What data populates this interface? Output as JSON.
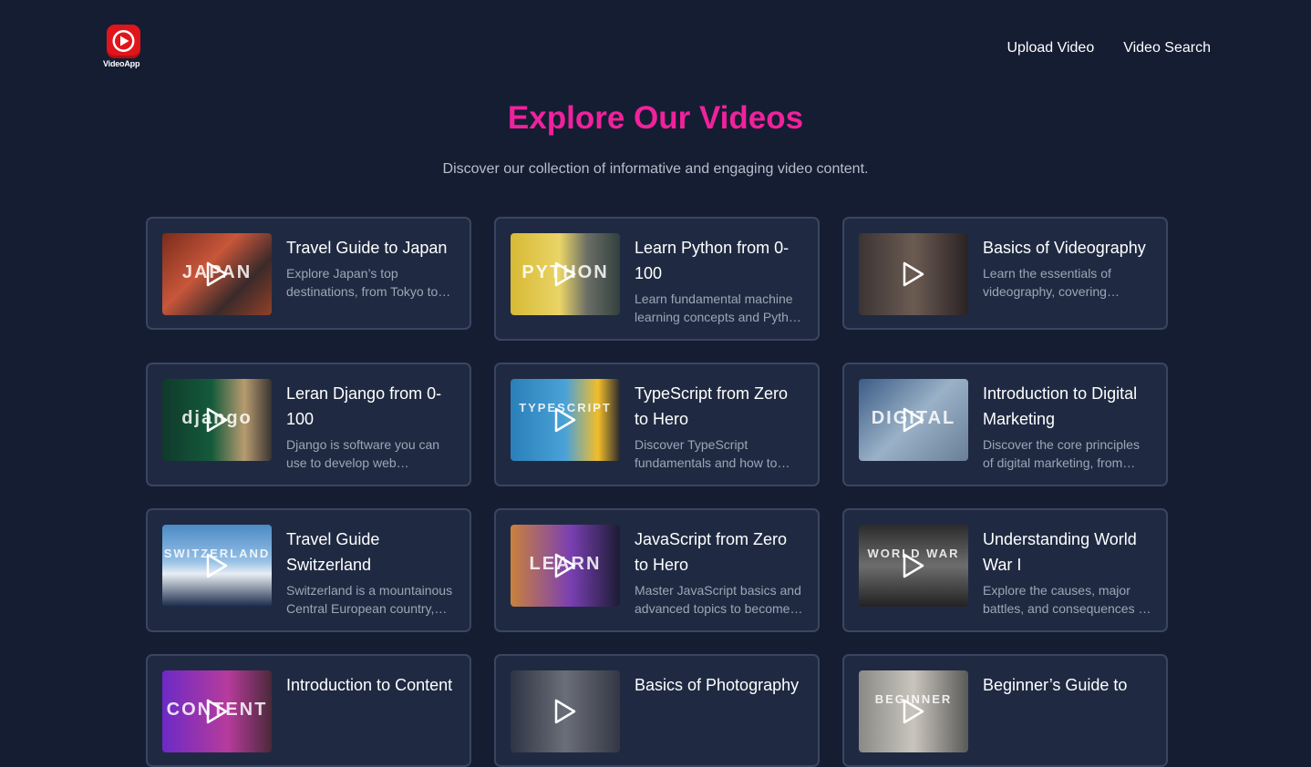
{
  "app": {
    "logo_text": "VideoApp",
    "colors": {
      "background": "#151d33",
      "accent": "#f0229b",
      "card": "#1f2a42",
      "logo_red": "#e0151b"
    }
  },
  "nav": {
    "upload": "Upload Video",
    "search": "Video Search"
  },
  "hero": {
    "title": "Explore Our Videos",
    "subtitle": "Discover our collection of informative and engaging video content."
  },
  "videos": [
    {
      "title": "Travel Guide to Japan",
      "description": "Explore Japan’s top destinations, from Tokyo to Kyoto, with tips on culture, food, and travel.",
      "thumb_text": "JAPAN"
    },
    {
      "title": "Learn Python from 0-100",
      "description": "Learn fundamental machine learning concepts and Python programming from scratch.",
      "thumb_text": "PYTHON"
    },
    {
      "title": "Basics of Videography",
      "description": "Learn the essentials of videography, covering cameras, lighting, and composition.",
      "thumb_text": ""
    },
    {
      "title": "Leran Django from 0-100",
      "description": "Django is software you can use to develop web applications quickly and efficiently.",
      "thumb_text": "django"
    },
    {
      "title": "TypeScript from Zero to Hero",
      "description": "Discover TypeScript fundamentals and how to build scalable applications.",
      "thumb_text": "TYPESCRIPT"
    },
    {
      "title": "Introduction to Digital Marketing",
      "description": "Discover the core principles of digital marketing, from SEO to social media.",
      "thumb_text": "DIGITAL"
    },
    {
      "title": "Travel Guide Switzerland",
      "description": "Switzerland is a mountainous Central European country, home to lakes and villages.",
      "thumb_text": "SWITZERLAND"
    },
    {
      "title": "JavaScript from Zero to Hero",
      "description": "Master JavaScript basics and advanced topics to become a confident developer.",
      "thumb_text": "LEARN"
    },
    {
      "title": "Understanding World War I",
      "description": "Explore the causes, major battles, and consequences of the First World War.",
      "thumb_text": "WORLD WAR"
    },
    {
      "title": "Introduction to Content",
      "description": "",
      "thumb_text": "CONTENT"
    },
    {
      "title": "Basics of Photography",
      "description": "",
      "thumb_text": ""
    },
    {
      "title": "Beginner’s Guide to",
      "description": "",
      "thumb_text": "BEGINNER"
    }
  ]
}
